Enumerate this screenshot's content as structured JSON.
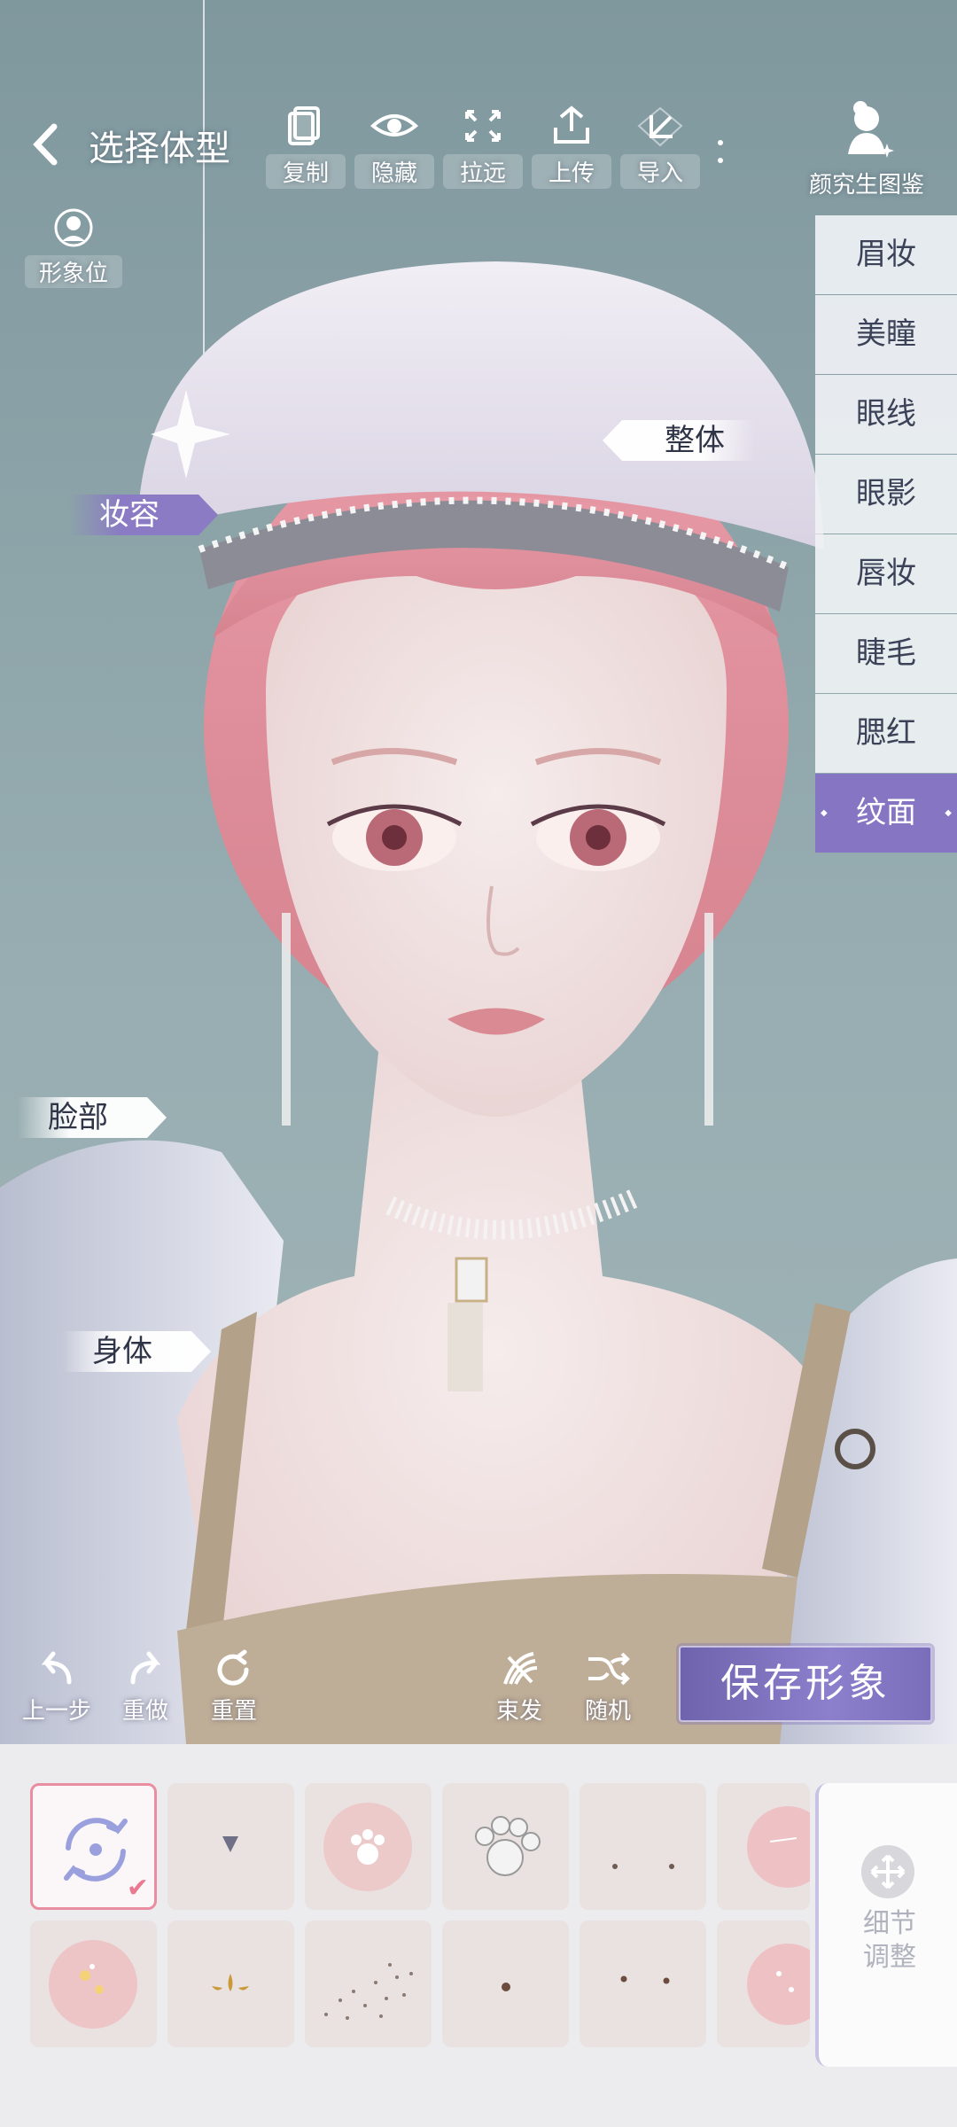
{
  "header": {
    "title": "选择体型",
    "tools": [
      {
        "label": "复制",
        "icon": "copy-icon"
      },
      {
        "label": "隐藏",
        "icon": "eye-icon"
      },
      {
        "label": "拉远",
        "icon": "zoom-out-icon"
      },
      {
        "label": "上传",
        "icon": "upload-icon"
      },
      {
        "label": "导入",
        "icon": "import-icon"
      }
    ],
    "guide_label": "颜究生图鉴",
    "image_position_label": "形象位"
  },
  "tags": {
    "overall": "整体",
    "makeup": "妆容",
    "face": "脸部",
    "body": "身体"
  },
  "categories": [
    {
      "label": "眉妆",
      "active": false
    },
    {
      "label": "美瞳",
      "active": false
    },
    {
      "label": "眼线",
      "active": false
    },
    {
      "label": "眼影",
      "active": false
    },
    {
      "label": "唇妆",
      "active": false
    },
    {
      "label": "睫毛",
      "active": false
    },
    {
      "label": "腮红",
      "active": false
    },
    {
      "label": "纹面",
      "active": true
    }
  ],
  "bottom_tools": {
    "undo": "上一步",
    "redo": "重做",
    "reset": "重置",
    "tie_hair": "束发",
    "random": "随机"
  },
  "save_label": "保存形象",
  "detail_label_line1": "细节",
  "detail_label_line2": "调整",
  "colors": {
    "accent": "#8575c2",
    "selected_border": "#e98ea0"
  }
}
